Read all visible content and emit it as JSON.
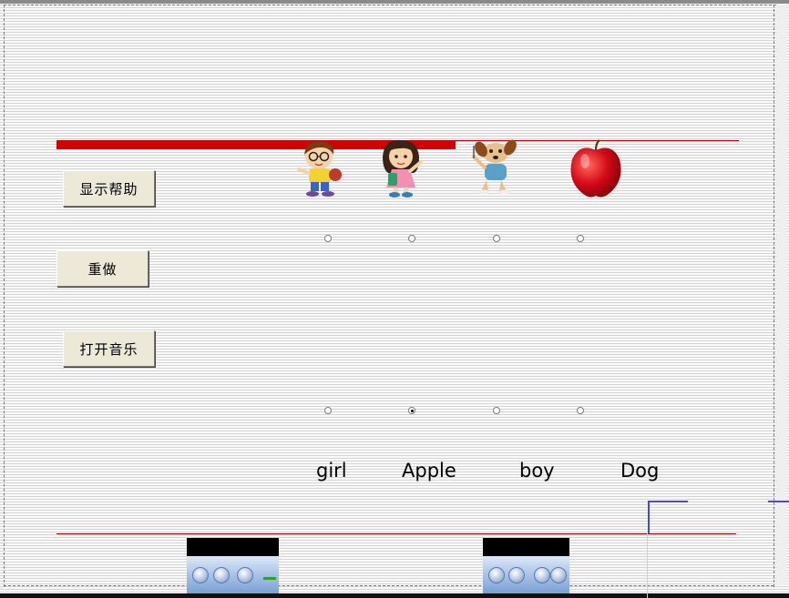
{
  "buttons": {
    "show_help": "显示帮助",
    "redo": "重做",
    "open_music": "打开音乐"
  },
  "pictures": [
    {
      "name": "boy-picture",
      "alt": "boy"
    },
    {
      "name": "girl-picture",
      "alt": "girl"
    },
    {
      "name": "dog-picture",
      "alt": "dog"
    },
    {
      "name": "apple-picture",
      "alt": "apple"
    }
  ],
  "words": [
    "girl",
    "Apple",
    "boy",
    "Dog"
  ],
  "radios_top": [
    false,
    false,
    false,
    false
  ],
  "radios_bottom": [
    false,
    true,
    false,
    false
  ],
  "colors": {
    "accent_red": "#d40000",
    "button_face": "#ece9d8",
    "player_blue": "#a9c3e6"
  },
  "players": [
    {
      "name": "media-player-1",
      "icons": [
        "play-icon",
        "stop-icon",
        "volume-icon"
      ]
    },
    {
      "name": "media-player-2",
      "icons": [
        "play-icon",
        "stop-icon",
        "prev-icon",
        "next-icon"
      ]
    }
  ]
}
